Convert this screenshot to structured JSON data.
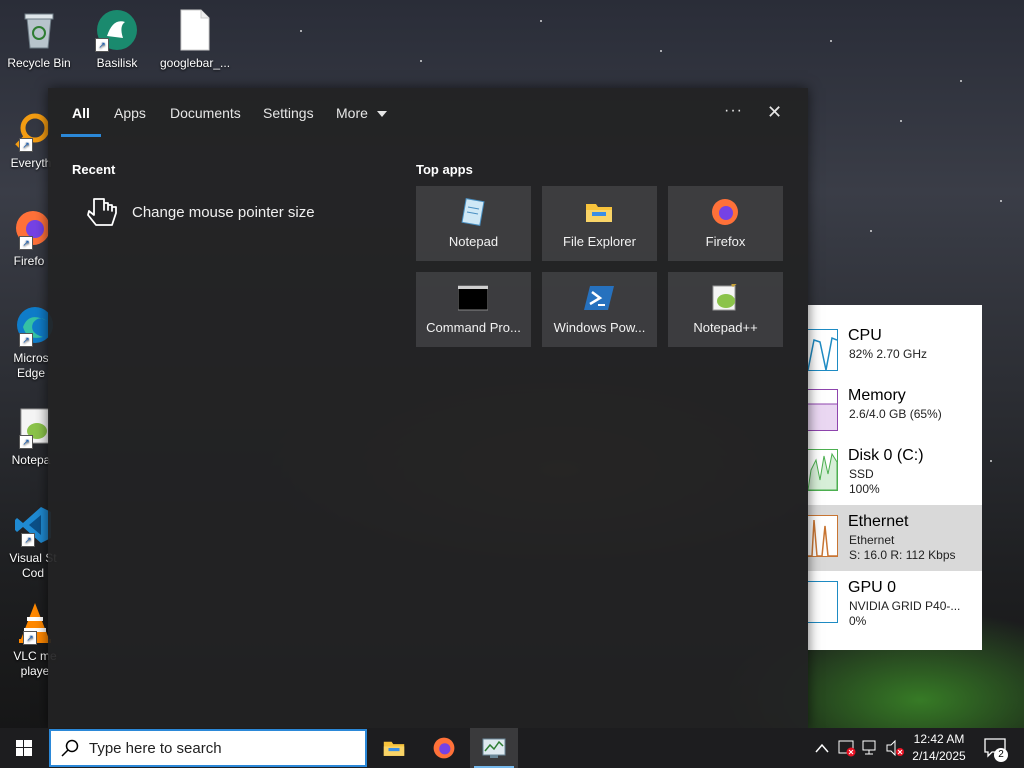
{
  "desktop": {
    "icons": [
      {
        "label": "Recycle Bin",
        "icon": "recycle-bin-icon"
      },
      {
        "label": "Basilisk",
        "icon": "basilisk-icon"
      },
      {
        "label": "googlebar_...",
        "icon": "file-icon"
      },
      {
        "label": "Everyth",
        "icon": "everything-search-icon"
      },
      {
        "label": "Firefo",
        "icon": "firefox-icon"
      },
      {
        "label": "Micros",
        "label2": "Edge",
        "icon": "edge-icon"
      },
      {
        "label": "Notepa",
        "icon": "notepadpp-icon"
      },
      {
        "label": "Visual St",
        "label2": "Cod",
        "icon": "vscode-icon"
      },
      {
        "label": "VLC me",
        "label2": "playe",
        "icon": "vlc-icon"
      }
    ]
  },
  "search_panel": {
    "tabs": [
      "All",
      "Apps",
      "Documents",
      "Settings",
      "More"
    ],
    "active_tab": "All",
    "recent_label": "Recent",
    "recent_items": [
      {
        "label": "Change mouse pointer size",
        "icon": "hand-pointer-icon"
      }
    ],
    "top_apps_label": "Top apps",
    "top_apps": [
      {
        "label": "Notepad",
        "icon": "notepad-icon"
      },
      {
        "label": "File Explorer",
        "icon": "folder-icon"
      },
      {
        "label": "Firefox",
        "icon": "firefox-icon"
      },
      {
        "label": "Command Pro...",
        "icon": "command-prompt-icon"
      },
      {
        "label": "Windows Pow...",
        "icon": "powershell-icon"
      },
      {
        "label": "Notepad++",
        "icon": "notepadpp-icon"
      }
    ],
    "more_options_glyph": "···",
    "close_glyph": "✕"
  },
  "task_manager": {
    "items": [
      {
        "title": "CPU",
        "sub1": "82%  2.70 GHz",
        "sub2": "",
        "color": "#1e8bc3"
      },
      {
        "title": "Memory",
        "sub1": "2.6/4.0 GB (65%)",
        "sub2": "",
        "color": "#8e44ad"
      },
      {
        "title": "Disk 0 (C:)",
        "sub1": "SSD",
        "sub2": "100%",
        "color": "#4caf50"
      },
      {
        "title": "Ethernet",
        "sub1": "Ethernet",
        "sub2": "S: 16.0  R: 112 Kbps",
        "color": "#c87533"
      },
      {
        "title": "GPU 0",
        "sub1": "NVIDIA GRID P40-...",
        "sub2": "0%",
        "color": "#1e8bc3"
      }
    ],
    "selected": "Ethernet"
  },
  "taskbar": {
    "search_placeholder": "Type here to search",
    "pinned": [
      "file-explorer-icon",
      "firefox-icon",
      "task-manager-icon"
    ],
    "time": "12:42 AM",
    "date": "2/14/2025",
    "notification_count": "2"
  },
  "colors": {
    "accent": "#2b88d8",
    "panel_bg": "#222224"
  }
}
